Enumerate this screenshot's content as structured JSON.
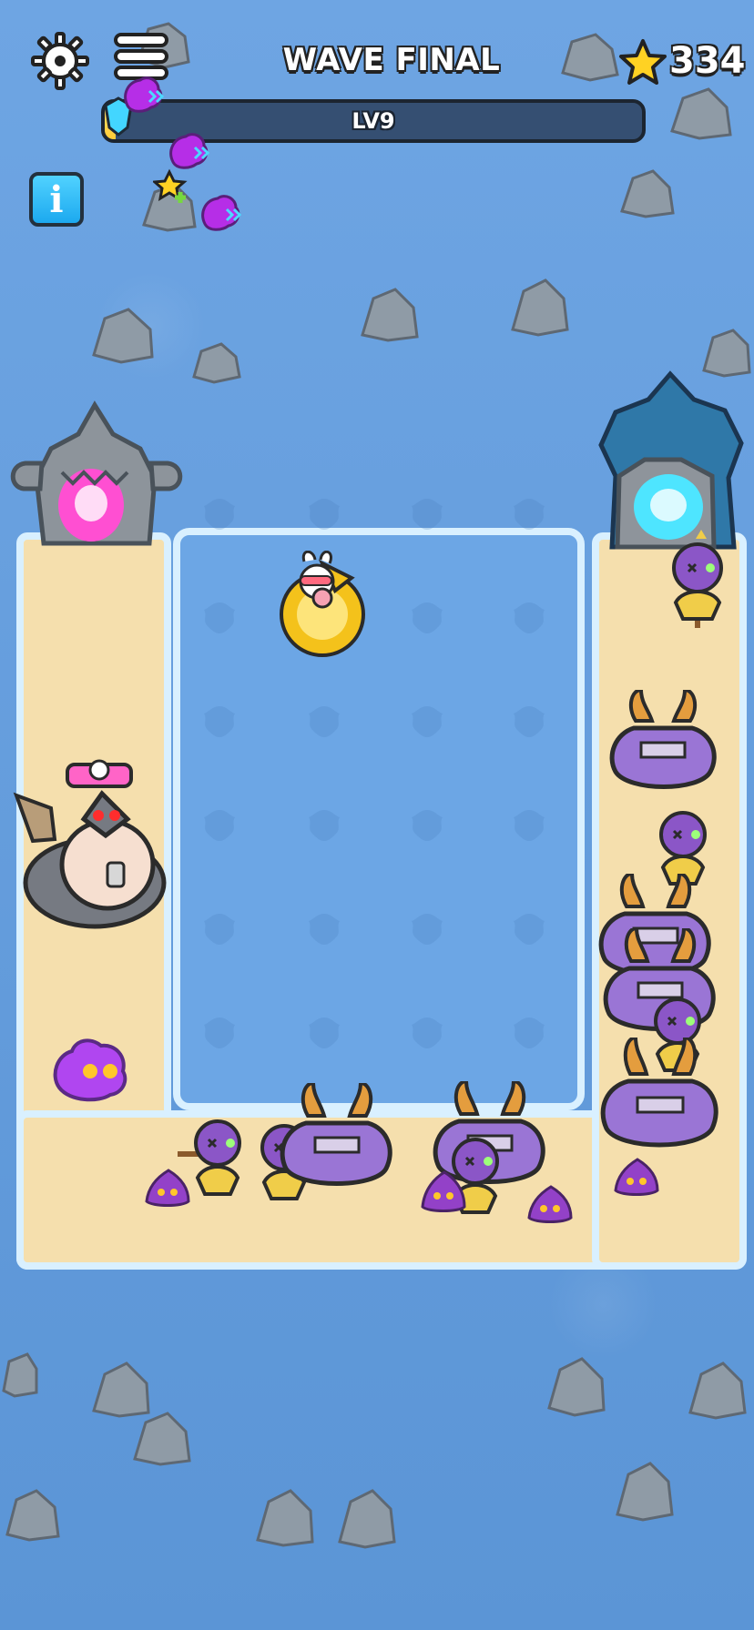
{
  "hud": {
    "wave_title": "WAVE FINAL",
    "star_count": "334",
    "level_label": "LV9",
    "level_progress": 0.02,
    "info_label": "i"
  },
  "colors": {
    "water": "#6ea5e3",
    "sand": "#f5dfad",
    "hud_bar": "#354f72",
    "accent": "#1ca9ef",
    "star": "#ffcc35",
    "enemy": "#8b56c7"
  },
  "scene": {
    "player": "bunny-hero",
    "boss": "wolf-sheep-boss",
    "portals": [
      "left-pink-portal",
      "right-cyan-portal"
    ],
    "enemies": [
      "purple-ghost",
      "voodoo-doll",
      "horned-crab",
      "slime-blob"
    ]
  }
}
